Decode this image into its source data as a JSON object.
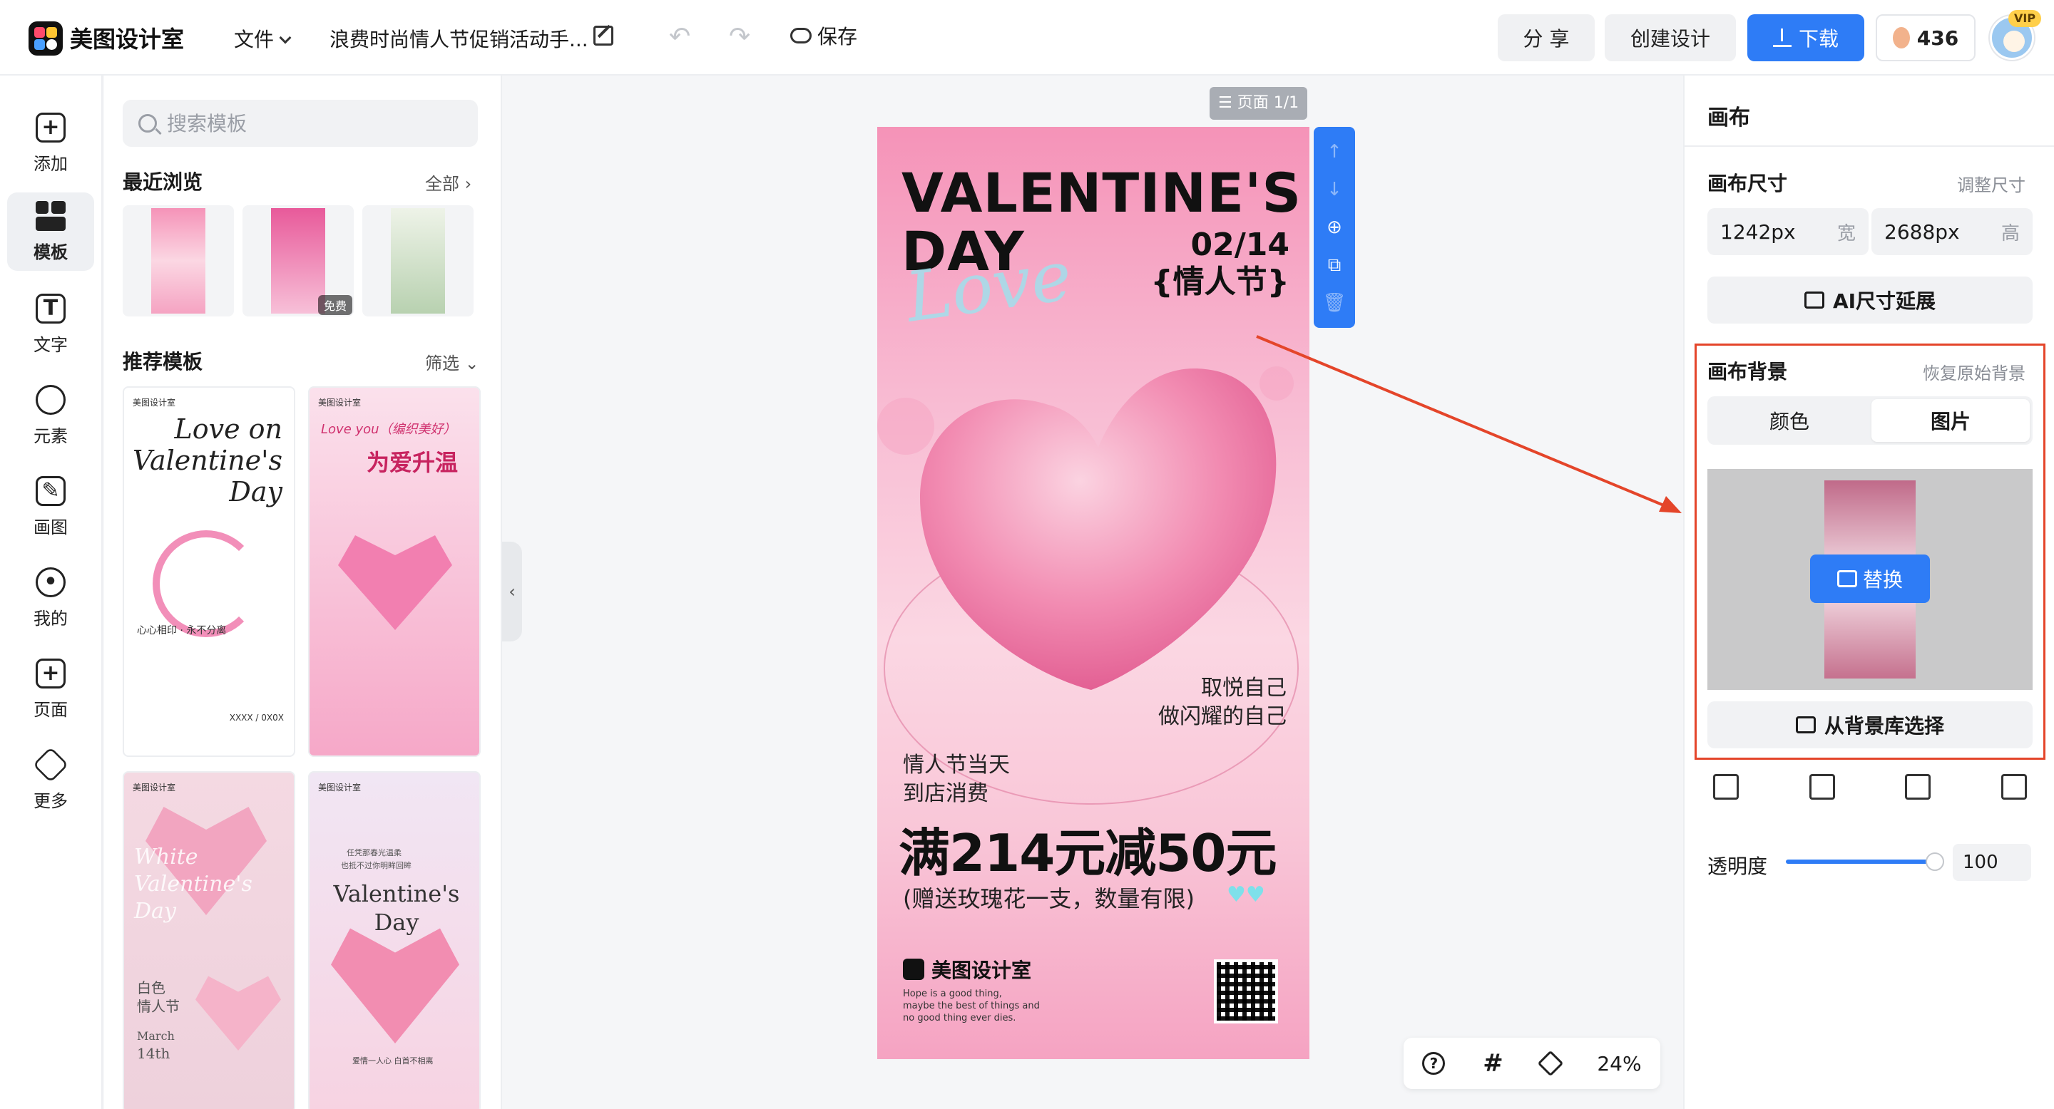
{
  "header": {
    "app_name": "美图设计室",
    "file_menu": "文件",
    "doc_title": "浪费时尚情人节促销活动手...",
    "save_label": "保存",
    "share_label": "分 享",
    "create_label": "创建设计",
    "download_label": "下载",
    "coins": "436",
    "vip_badge": "VIP"
  },
  "rail": {
    "items": [
      {
        "label": "添加",
        "icon": "plus-icon"
      },
      {
        "label": "模板",
        "icon": "template-icon"
      },
      {
        "label": "文字",
        "icon": "text-icon"
      },
      {
        "label": "元素",
        "icon": "shapes-icon"
      },
      {
        "label": "画图",
        "icon": "draw-icon"
      },
      {
        "label": "我的",
        "icon": "user-icon"
      },
      {
        "label": "页面",
        "icon": "page-icon"
      },
      {
        "label": "更多",
        "icon": "box-icon"
      }
    ],
    "active": "模板"
  },
  "templates": {
    "search_placeholder": "搜索模板",
    "recent_title": "最近浏览",
    "recent_link": "全部",
    "free_badge": "免费",
    "recommend_title": "推荐模板",
    "filter_label": "筛选",
    "cards": [
      {
        "brand": "美图设计室",
        "title": "Love on Valentine's Day",
        "bottom": "心心相印 · 永不分离",
        "footer": "XXXX / 0X0X"
      },
      {
        "brand": "美图设计室",
        "title": "Love you（编织美好）",
        "headline": "为爱升温"
      },
      {
        "brand": "美图设计室",
        "title": "White Valentine's Day",
        "sub1": "白色",
        "sub2": "情人节",
        "date1": "March",
        "date2": "14th"
      },
      {
        "brand": "美图设计室",
        "title": "Valentine's Day",
        "top_text1": "任凭那春光温柔",
        "top_text2": "也抵不过你明眸回眸",
        "bottom": "爱情一人心 白首不相离"
      }
    ]
  },
  "canvas": {
    "page_indicator": "页面 1/1",
    "poster": {
      "title_line1": "VALENTINE'S",
      "title_line2": "DAY",
      "script": "Love",
      "date": "02/14",
      "festival": "{情人节}",
      "slogan1": "取悦自己",
      "slogan2": "做闪耀的自己",
      "sub1": "情人节当天",
      "sub2": "到店消费",
      "promo": "满214元减50元",
      "gift": "(赠送玫瑰花一支，数量有限)",
      "brand": "美图设计室",
      "tagline1": "Hope is a good thing,",
      "tagline2": "maybe the best of things and",
      "tagline3": "no good thing ever dies."
    },
    "zoom": "24%"
  },
  "right_panel": {
    "title": "画布",
    "size_label": "画布尺寸",
    "resize_link": "调整尺寸",
    "width_value": "1242px",
    "width_unit": "宽",
    "height_value": "2688px",
    "height_unit": "高",
    "ai_extend": "AI尺寸延展",
    "bg_label": "画布背景",
    "restore_link": "恢复原始背景",
    "seg_color": "颜色",
    "seg_image": "图片",
    "replace_label": "替换",
    "library_label": "从背景库选择",
    "opacity_label": "透明度",
    "opacity_value": "100"
  },
  "colors": {
    "accent": "#2e7cf6",
    "highlight_border": "#e4452a",
    "poster_pink": "#f593b8"
  }
}
